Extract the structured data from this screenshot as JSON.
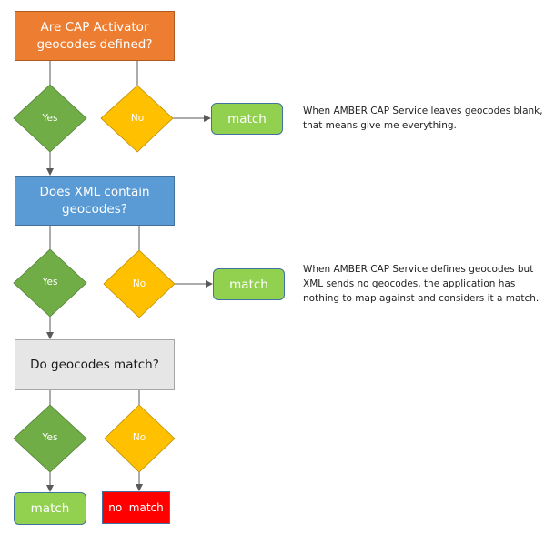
{
  "colors": {
    "orange": "#ED7D31",
    "blue": "#5B9BD5",
    "gray": "#E7E6E6",
    "yes_green": "#70AD47",
    "no_yellow": "#FFC000",
    "match_green": "#92D050",
    "no_match_red": "#FF0000",
    "connector": "#595959"
  },
  "steps": [
    {
      "question": "Are CAP Activator geocodes defined?",
      "yes_label": "Yes",
      "no_label": "No",
      "no_outcome": "match",
      "note": "When AMBER  CAP Service leaves geocodes blank, that means give me everything."
    },
    {
      "question": "Does XML contain geocodes?",
      "yes_label": "Yes",
      "no_label": "No",
      "no_outcome": "match",
      "note": "When AMBER  CAP Service defines geocodes  but XML sends no geocodes, the application has nothing to map against and considers it a match."
    },
    {
      "question": "Do geocodes match?",
      "yes_label": "Yes",
      "no_label": "No",
      "yes_outcome": "match",
      "no_outcome": "no  match"
    }
  ]
}
